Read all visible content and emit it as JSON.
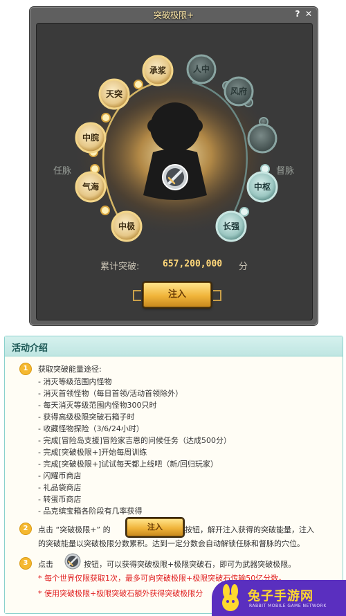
{
  "window": {
    "title": "突破极限+",
    "help": "?",
    "close": "✕",
    "left_meridian": "任脉",
    "right_meridian": "督脉",
    "left_nodes": [
      "承浆",
      "天突",
      "中脘",
      "气海",
      "中极"
    ],
    "right_nodes": [
      "人中",
      "风府",
      "",
      "中枢",
      "长强"
    ],
    "score_label": "累计突破:",
    "score_value": "657,200,000",
    "score_unit": "分",
    "inject_button": "注入"
  },
  "panel": {
    "title": "活动介绍",
    "section1": {
      "number": "1",
      "heading": "获取突破能量途径:",
      "items": [
        "- 消灭等级范围内怪物",
        "- 消灭首领怪物（每日首领/活动首领除外）",
        "- 每天消灭等级范围内怪物300只时",
        "- 获得高级极限突破石箱子时",
        "- 收藏怪物探险（3/6/24小时）",
        "- 完成[冒险岛支援]冒险家吉恩的问候任务（达成500分）",
        "- 完成[突破极限+]开始每周训练",
        "- 完成[突破极限+]试试每天都上线吧（新/回归玩家）",
        "- 闪耀币商店",
        "- 礼品袋商店",
        "- 转蛋币商店",
        "- 品克缤宝箱各阶段有几率获得"
      ]
    },
    "section2": {
      "number": "2",
      "text_before": "点击 “突破极限+” 的",
      "button": "注入",
      "text_after": "按钮，解开注入获得的突破能量，注入",
      "line2": "的突破能量以突破极限分数累积。达到一定分数会自动解锁任脉和督脉的穴位。"
    },
    "section3": {
      "number": "3",
      "text_before": "点击",
      "text_after": "按钮，可以获得突破极限+极限突破石，即可为武器突破极限。",
      "note1": "* 每个世界仅限获取1次，最多可向突破极限+极限突破石传输50亿分数。",
      "note2": "* 使用突破极限+极限突破石额外获得突破极限分"
    }
  },
  "watermark": {
    "name": "兔子手游网",
    "sub": "RABBIT MOBILE GAME NETWORK"
  },
  "colors": {
    "gold": "#f0b43a",
    "jade": "#7fb5b0",
    "accent_red": "#e02020",
    "panel_border": "#8ad1cc",
    "watermark_bg": "#5a2fbf"
  }
}
